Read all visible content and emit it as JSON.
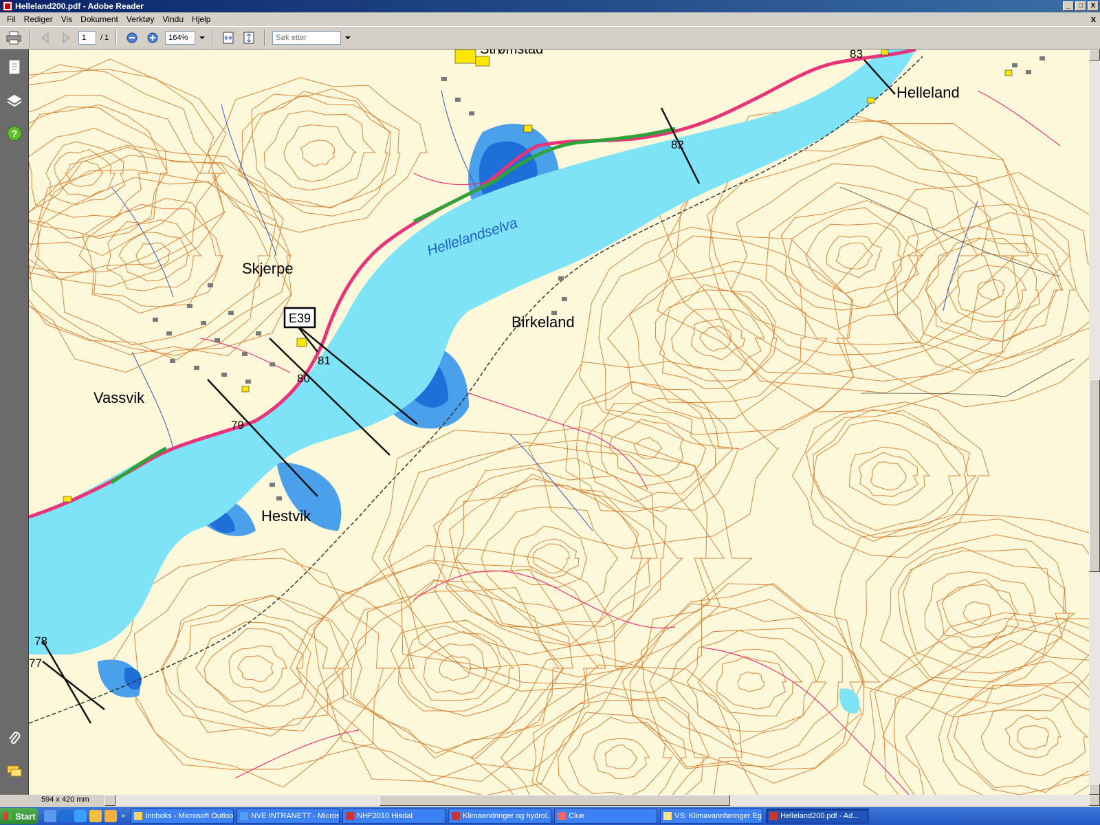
{
  "window": {
    "title": "Helleland200.pdf - Adobe Reader",
    "minimize_label": "_",
    "maximize_label": "□",
    "close_label": "X"
  },
  "menu": {
    "items": [
      "Fil",
      "Rediger",
      "Vis",
      "Dokument",
      "Verktøy",
      "Vindu",
      "Hjelp"
    ],
    "close_label": "x"
  },
  "toolbar": {
    "page_current": "1",
    "page_total": "/ 1",
    "zoom": "164%",
    "search_placeholder": "Søk etter",
    "icons": [
      "print-icon",
      "previous-page-icon",
      "next-page-icon",
      "zoom-out-icon",
      "zoom-in-icon",
      "fit-width-icon",
      "fit-page-icon"
    ]
  },
  "nav_pane": {
    "icons": [
      "pages-icon",
      "layers-icon",
      "help-icon",
      "attachments-icon",
      "comments-icon"
    ]
  },
  "map": {
    "place_names": [
      "Strømstad",
      "Helleland",
      "Skjerpe",
      "Vassvik",
      "Birkeland",
      "Hestvik"
    ],
    "river_name": "Hellelandselva",
    "road_shield": "E39",
    "profile_numbers": [
      "77",
      "78",
      "79",
      "80",
      "81",
      "82",
      "83"
    ],
    "colors": {
      "background": "#fdf8d9",
      "water": "#7fe3f7",
      "flood_dark": "#1f6fd8",
      "flood_mid": "#4aa0ea",
      "contour": "#d7843a",
      "road_main": "#e8347a",
      "road_green": "#2fa33a",
      "stream": "#3a56c8",
      "building": "#7a7a7a",
      "building_yellow": "#ffe600"
    }
  },
  "status": {
    "page_size": "594 x 420 mm"
  },
  "taskbar": {
    "start_label": "Start",
    "tasks": [
      {
        "label": "Innboks - Microsoft Outlook",
        "active": false
      },
      {
        "label": "NVE INTRANETT - Micros...",
        "active": false
      },
      {
        "label": "NHF2010 Hisdal",
        "active": false
      },
      {
        "label": "Klimaendringer og hydrol...",
        "active": false
      },
      {
        "label": "Clue",
        "active": false
      },
      {
        "label": "VS: Klimavannføringer Eg...",
        "active": false
      },
      {
        "label": "Helleland200.pdf - Ad...",
        "active": true
      }
    ],
    "more_label": "»"
  }
}
